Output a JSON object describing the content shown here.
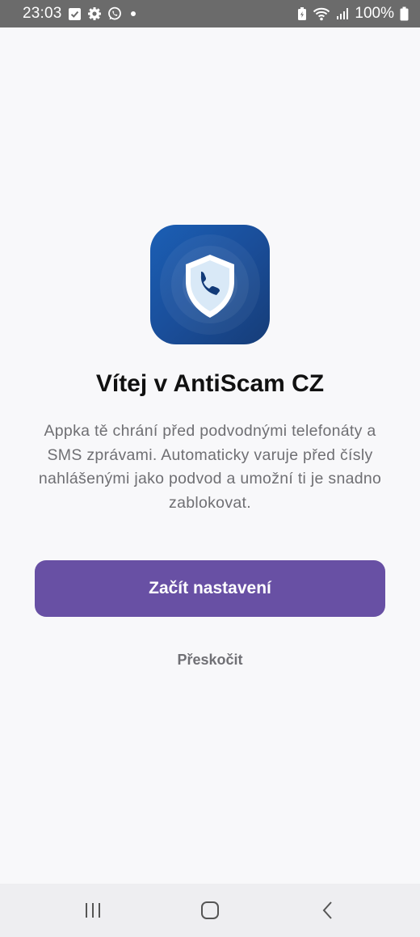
{
  "status_bar": {
    "time": "23:03",
    "battery": "100%",
    "icons_left": [
      "check-notification-icon",
      "settings-icon",
      "whatsapp-icon",
      "dot-icon"
    ],
    "icons_right": [
      "battery-saver-icon",
      "wifi-icon",
      "signal-icon",
      "battery-icon"
    ]
  },
  "app": {
    "icon": "shield-phone-icon",
    "title": "Vítej v AntiScam CZ",
    "description": "Appka tě chrání před podvodnými telefonáty a SMS zprávami. Automaticky varuje před čísly nahlášenými jako podvod a umožní ti je snadno zablokovat.",
    "primary_button": "Začít nastavení",
    "skip_link": "Přeskočit"
  },
  "nav_bar": {
    "buttons": [
      "recents-icon",
      "home-icon",
      "back-icon"
    ]
  },
  "colors": {
    "accent": "#6850a4",
    "icon_blue": "#1a4e9a",
    "status_bar": "#6b6b6b",
    "background": "#f8f8fa"
  }
}
